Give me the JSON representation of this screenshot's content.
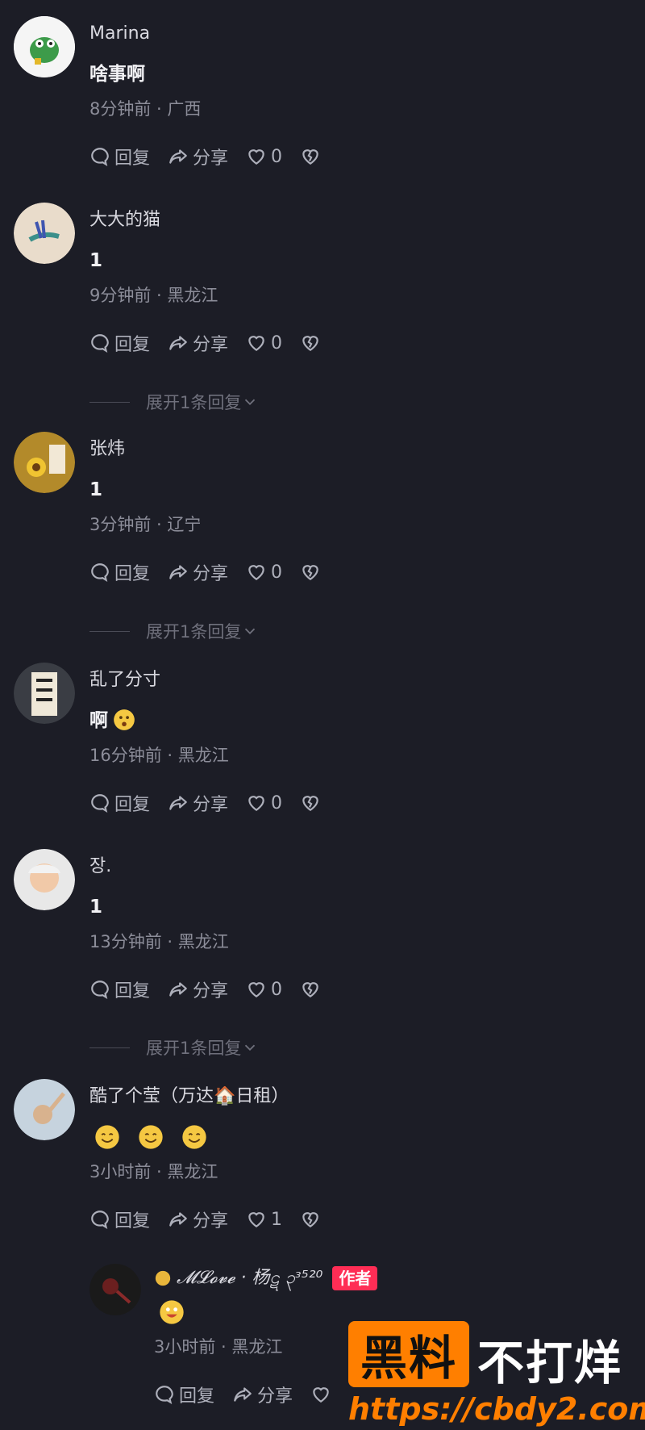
{
  "actions": {
    "reply": "回复",
    "share": "分享"
  },
  "expand_label": "展开1条回复",
  "comments": [
    {
      "username": "Marina",
      "text": "啥事啊",
      "meta": "8分钟前 · 广西",
      "likes": "0"
    },
    {
      "username": "大大的猫",
      "text": "1",
      "meta": "9分钟前 · 黑龙江",
      "likes": "0"
    },
    {
      "username": "张炜",
      "text": "1",
      "meta": "3分钟前 · 辽宁",
      "likes": "0"
    },
    {
      "username": "乱了分寸",
      "text": "啊",
      "meta": "16分钟前 · 黑龙江",
      "likes": "0"
    },
    {
      "username": "장.",
      "text": "1",
      "meta": "13分钟前 · 黑龙江",
      "likes": "0"
    },
    {
      "username": "酷了个莹（万达🏠日租）",
      "text": "",
      "meta": "3小时前 · 黑龙江",
      "likes": "1"
    }
  ],
  "reply": {
    "username": "𝓜𝓛𝓸𝓿𝓮 · 杨ဋ ၃ᵌ⁵²⁰",
    "badge": "作者",
    "meta": "3小时前 · 黑龙江"
  },
  "watermark": {
    "box_text": "黑料",
    "text": "不打烊",
    "url": "https://cbdy2.com"
  },
  "colors": {
    "background": "#1c1d26",
    "badge": "#ff2d55",
    "watermark": "#ff7f00"
  }
}
